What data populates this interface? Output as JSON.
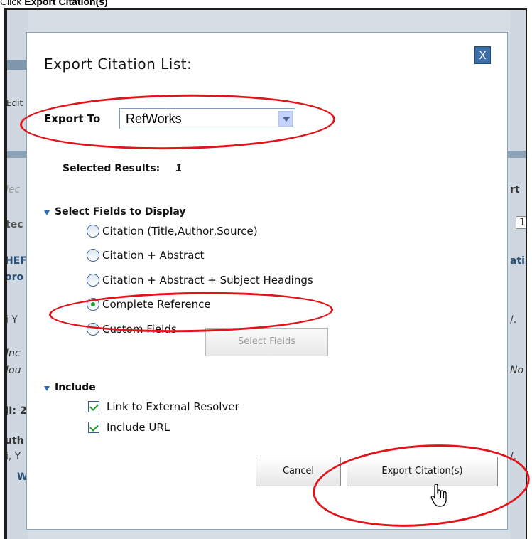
{
  "caption": {
    "prefix": "Click ",
    "emphasis": "Export Citation(s)"
  },
  "background": {
    "left_fragments": [
      "Edit",
      "lec",
      "tec",
      "HEF",
      "oro",
      "i Y",
      "Inc",
      "Jou",
      "JI: 2",
      "uth",
      "i, Y",
      "W"
    ],
    "right_fragments": [
      "rt",
      "1",
      "ati",
      "/.",
      "No",
      "/."
    ]
  },
  "dialog": {
    "title": "Export Citation List:",
    "close_label": "X",
    "export_to_label": "Export To",
    "export_to_value": "RefWorks",
    "selected_results_label": "Selected Results:",
    "selected_results_count": "1",
    "fields_heading": "Select Fields to Display",
    "field_options": [
      {
        "label": "Citation (Title,Author,Source)",
        "checked": false
      },
      {
        "label": "Citation + Abstract",
        "checked": false
      },
      {
        "label": "Citation + Abstract + Subject Headings",
        "checked": false
      },
      {
        "label": "Complete Reference",
        "checked": true
      },
      {
        "label": "Custom Fields",
        "checked": false
      }
    ],
    "select_fields_button": "Select Fields",
    "include_heading": "Include",
    "include_options": [
      {
        "label": "Link to External Resolver",
        "checked": true
      },
      {
        "label": "Include URL",
        "checked": true
      }
    ],
    "cancel_button": "Cancel",
    "export_button": "Export Citation(s)"
  },
  "colors": {
    "annotation": "#e1141b",
    "close_button": "#3c6fa8",
    "frame": "#1e1e1e"
  }
}
